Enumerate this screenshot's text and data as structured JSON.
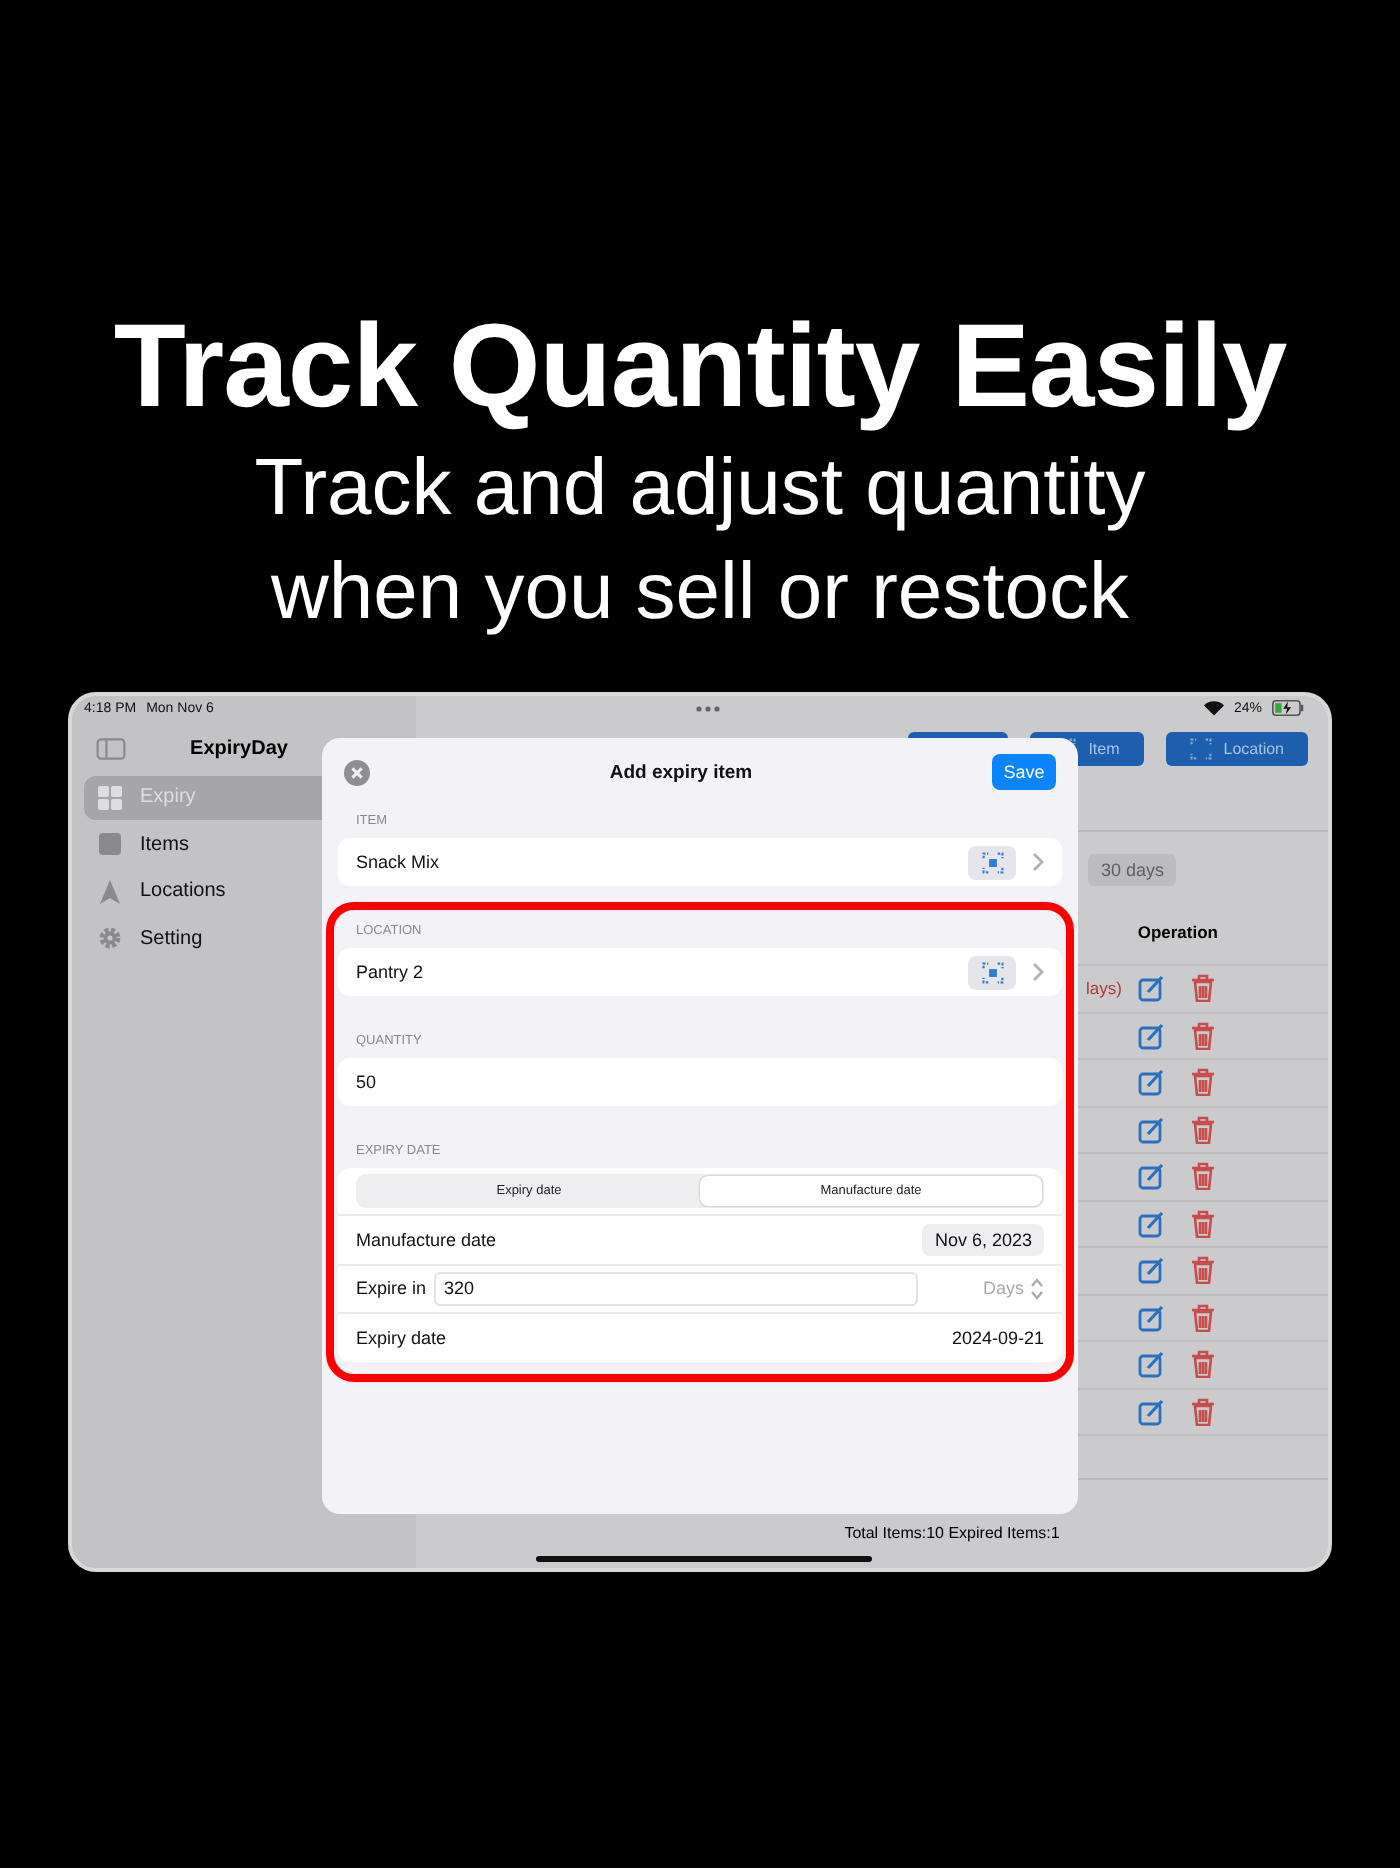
{
  "headline": "Track Quantity Easily",
  "subheadline": "Track and adjust quantity when you sell or restock",
  "status_bar": {
    "time": "4:18 PM",
    "date": "Mon Nov 6",
    "battery": "24%"
  },
  "sidebar": {
    "title": "ExpiryDay",
    "items": [
      {
        "label": "Expiry",
        "selected": true
      },
      {
        "label": "Items",
        "selected": false
      },
      {
        "label": "Locations",
        "selected": false
      },
      {
        "label": "Setting",
        "selected": false
      }
    ]
  },
  "main": {
    "toolbar_buttons": [
      {
        "label": "Item"
      },
      {
        "label": "Location"
      }
    ],
    "filter_chip": "30 days",
    "column": "Operation",
    "rows": [
      {
        "kind": "expiring",
        "note": "lays)"
      },
      {
        "kind": "normal"
      },
      {
        "kind": "normal"
      },
      {
        "kind": "normal"
      },
      {
        "kind": "normal"
      },
      {
        "kind": "normal"
      },
      {
        "kind": "normal"
      },
      {
        "kind": "normal"
      },
      {
        "kind": "normal"
      },
      {
        "kind": "normal"
      }
    ],
    "footer": "Total Items:10  Expired Items:1"
  },
  "modal": {
    "title": "Add expiry item",
    "save": "Save",
    "item": {
      "label": "ITEM",
      "value": "Snack Mix"
    },
    "location": {
      "label": "LOCATION",
      "value": "Pantry 2"
    },
    "quantity": {
      "label": "QUANTITY",
      "value": "50"
    },
    "expiry": {
      "label": "EXPIRY DATE",
      "segments": [
        {
          "label": "Expiry date",
          "selected": false
        },
        {
          "label": "Manufacture date",
          "selected": true
        }
      ],
      "manufacture_label": "Manufacture date",
      "manufacture_value": "Nov 6, 2023",
      "expire_in_label": "Expire in",
      "expire_in_value": "320",
      "unit": "Days",
      "expiry_label": "Expiry date",
      "expiry_value": "2024-09-21"
    }
  }
}
